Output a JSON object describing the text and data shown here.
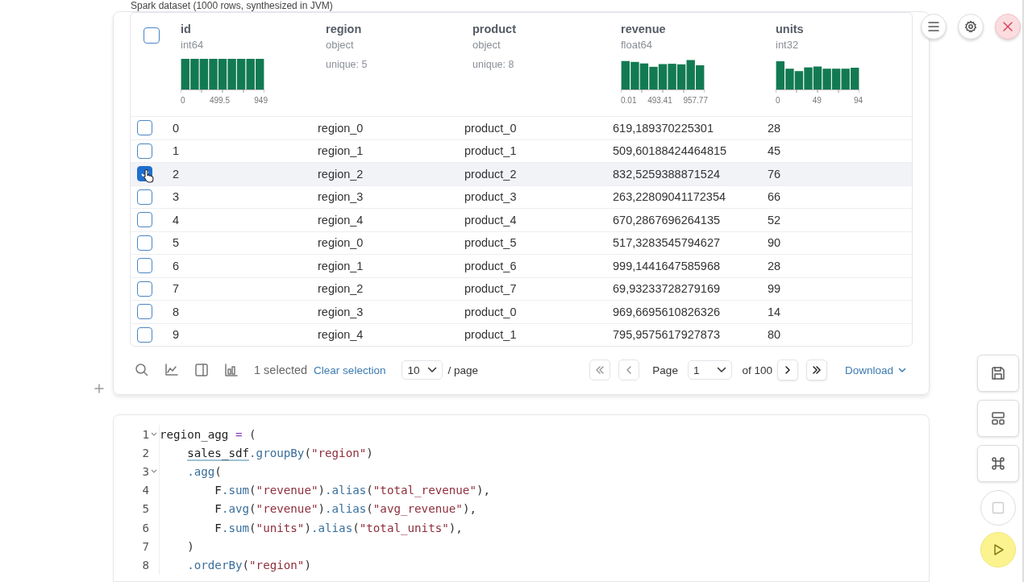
{
  "cell_title": "Spark dataset (1000 rows, synthesized in JVM)",
  "table": {
    "header_checked": false,
    "columns": [
      {
        "name": "id",
        "dtype": "int64",
        "histogram": {
          "ticks": [
            "0",
            "499.5",
            "949"
          ]
        }
      },
      {
        "name": "region",
        "dtype": "object",
        "stat": "unique: 5"
      },
      {
        "name": "product",
        "dtype": "object",
        "stat": "unique: 8"
      },
      {
        "name": "revenue",
        "dtype": "float64",
        "histogram": {
          "ticks": [
            "0.01",
            "493.41",
            "957.77"
          ]
        }
      },
      {
        "name": "units",
        "dtype": "int32",
        "histogram": {
          "ticks": [
            "0",
            "49",
            "94"
          ]
        }
      }
    ],
    "rows": [
      {
        "selected": false,
        "cells": [
          "0",
          "region_0",
          "product_0",
          "619,189370225301",
          "28"
        ]
      },
      {
        "selected": false,
        "cells": [
          "1",
          "region_1",
          "product_1",
          "509,60188424464815",
          "45"
        ]
      },
      {
        "selected": true,
        "cells": [
          "2",
          "region_2",
          "product_2",
          "832,5259388871524",
          "76"
        ]
      },
      {
        "selected": false,
        "cells": [
          "3",
          "region_3",
          "product_3",
          "263,22809041172354",
          "66"
        ]
      },
      {
        "selected": false,
        "cells": [
          "4",
          "region_4",
          "product_4",
          "670,2867696264135",
          "52"
        ]
      },
      {
        "selected": false,
        "cells": [
          "5",
          "region_0",
          "product_5",
          "517,3283545794627",
          "90"
        ]
      },
      {
        "selected": false,
        "cells": [
          "6",
          "region_1",
          "product_6",
          "999,1441647585968",
          "28"
        ]
      },
      {
        "selected": false,
        "cells": [
          "7",
          "region_2",
          "product_7",
          "69,93233728279169",
          "99"
        ]
      },
      {
        "selected": false,
        "cells": [
          "8",
          "region_3",
          "product_0",
          "969,6695610826326",
          "14"
        ]
      },
      {
        "selected": false,
        "cells": [
          "9",
          "region_4",
          "product_1",
          "795,9575617927873",
          "80"
        ]
      }
    ]
  },
  "footer": {
    "selection": "1 selected",
    "clear": "Clear selection",
    "page_size": "10",
    "per_page": "/ page",
    "page_label": "Page",
    "page": "1",
    "of": "of 100",
    "download": "Download"
  },
  "code": [
    {
      "number": "1",
      "fold": true,
      "tokens": [
        {
          "kind": "name",
          "text": "region_agg "
        },
        {
          "kind": "op",
          "text": "="
        },
        {
          "kind": "punct",
          "text": " ("
        }
      ]
    },
    {
      "number": "2",
      "fold": false,
      "tokens": [
        {
          "kind": "linted",
          "text": "    sales_sdf"
        },
        {
          "kind": "method",
          "text": ".groupBy"
        },
        {
          "kind": "punct",
          "text": "("
        },
        {
          "kind": "string",
          "text": "\"region\""
        },
        {
          "kind": "punct",
          "text": ")"
        }
      ]
    },
    {
      "number": "3",
      "fold": true,
      "tokens": [
        {
          "kind": "method",
          "text": "    .agg"
        },
        {
          "kind": "punct",
          "text": "("
        }
      ]
    },
    {
      "number": "4",
      "fold": false,
      "tokens": [
        {
          "kind": "name",
          "text": "        F"
        },
        {
          "kind": "method",
          "text": ".sum"
        },
        {
          "kind": "punct",
          "text": "("
        },
        {
          "kind": "string",
          "text": "\"revenue\""
        },
        {
          "kind": "punct",
          "text": ")"
        },
        {
          "kind": "method",
          "text": ".alias"
        },
        {
          "kind": "punct",
          "text": "("
        },
        {
          "kind": "string",
          "text": "\"total_revenue\""
        },
        {
          "kind": "punct",
          "text": "),"
        }
      ]
    },
    {
      "number": "5",
      "fold": false,
      "tokens": [
        {
          "kind": "name",
          "text": "        F"
        },
        {
          "kind": "method",
          "text": ".avg"
        },
        {
          "kind": "punct",
          "text": "("
        },
        {
          "kind": "string",
          "text": "\"revenue\""
        },
        {
          "kind": "punct",
          "text": ")"
        },
        {
          "kind": "method",
          "text": ".alias"
        },
        {
          "kind": "punct",
          "text": "("
        },
        {
          "kind": "string",
          "text": "\"avg_revenue\""
        },
        {
          "kind": "punct",
          "text": "),"
        }
      ]
    },
    {
      "number": "6",
      "fold": false,
      "tokens": [
        {
          "kind": "name",
          "text": "        F"
        },
        {
          "kind": "method",
          "text": ".sum"
        },
        {
          "kind": "punct",
          "text": "("
        },
        {
          "kind": "string",
          "text": "\"units\""
        },
        {
          "kind": "punct",
          "text": ")"
        },
        {
          "kind": "method",
          "text": ".alias"
        },
        {
          "kind": "punct",
          "text": "("
        },
        {
          "kind": "string",
          "text": "\"total_units\""
        },
        {
          "kind": "punct",
          "text": "),"
        }
      ]
    },
    {
      "number": "7",
      "fold": false,
      "tokens": [
        {
          "kind": "punct",
          "text": "    )"
        }
      ]
    },
    {
      "number": "8",
      "fold": false,
      "tokens": [
        {
          "kind": "method",
          "text": "    .orderBy"
        },
        {
          "kind": "punct",
          "text": "("
        },
        {
          "kind": "string",
          "text": "\"region\""
        },
        {
          "kind": "punct",
          "text": ")"
        }
      ]
    }
  ]
}
